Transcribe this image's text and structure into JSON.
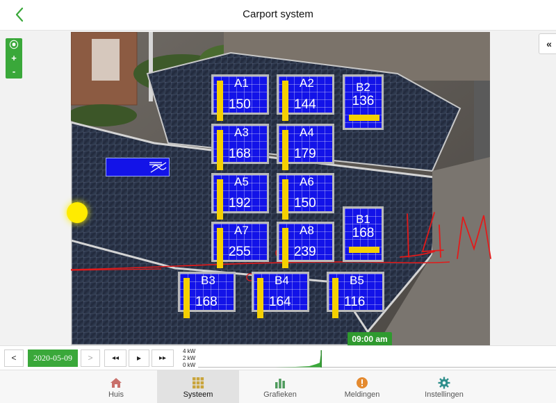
{
  "header": {
    "title": "Carport system"
  },
  "map_controls": {
    "locate": "⦿",
    "zoom_in": "+",
    "zoom_out": "-"
  },
  "collapse": "«",
  "panels": [
    {
      "id": "A1",
      "value": "150"
    },
    {
      "id": "A2",
      "value": "144"
    },
    {
      "id": "B2",
      "value": "136"
    },
    {
      "id": "A3",
      "value": "168"
    },
    {
      "id": "A4",
      "value": "179"
    },
    {
      "id": "A5",
      "value": "192"
    },
    {
      "id": "A6",
      "value": "150"
    },
    {
      "id": "B1",
      "value": "168"
    },
    {
      "id": "A7",
      "value": "255"
    },
    {
      "id": "A8",
      "value": "239"
    },
    {
      "id": "B3",
      "value": "168"
    },
    {
      "id": "B4",
      "value": "164"
    },
    {
      "id": "B5",
      "value": "116"
    }
  ],
  "annotation_text": "14M",
  "time_badge": "09:00 am",
  "timeline": {
    "prev": "<",
    "date": "2020-05-09",
    "next": ">",
    "rewind": "◂◂",
    "play": "▸",
    "forward": "▸▸",
    "y_labels": [
      "4 kW",
      "2 kW",
      "0 kW"
    ]
  },
  "nav": [
    {
      "label": "Huis",
      "icon": "house-icon",
      "color": "#c9706b",
      "active": false
    },
    {
      "label": "Systeem",
      "icon": "grid-icon",
      "color": "#c9a43b",
      "active": true
    },
    {
      "label": "Grafieken",
      "icon": "bar-chart-icon",
      "color": "#4e9a5c",
      "active": false
    },
    {
      "label": "Meldingen",
      "icon": "alert-icon",
      "color": "#e48a2f",
      "active": false
    },
    {
      "label": "Instellingen",
      "icon": "gear-icon",
      "color": "#2f8f8c",
      "active": false
    }
  ],
  "colors": {
    "brand_green": "#3aa83a",
    "panel_blue": "#1313e8",
    "production_yellow": "#f5d000",
    "annotation_red": "#e31a1a"
  }
}
